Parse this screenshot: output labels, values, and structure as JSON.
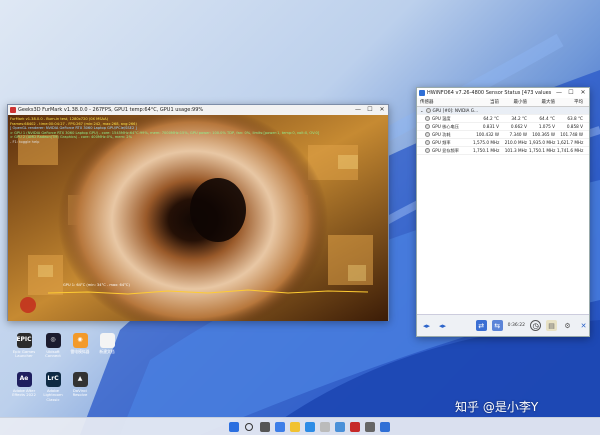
{
  "furmark": {
    "title": "Geeks3D FurMark v1.38.0.0 - 267FPS, GPU1 temp:64°C, GPU1 usage:99%",
    "osd": [
      {
        "text": "FurMark v1.38.0.0 - Burn-in test, 1280x720 (0X MSAA)",
        "color": "#ffe34a"
      },
      {
        "text": "Frames:68402 - time:00:04:27 - FPS:267 (min:242, max:268, avg:266)",
        "color": "#ffe34a"
      },
      {
        "text": "[ OpenGL renderer: NVIDIA GeForce RTX 3060 Laptop GPU/PCIe/SSE2 ]",
        "color": "#9fd9ff"
      },
      {
        "text": "> GPU 1 (NVIDIA GeForce RTX 3060 Laptop GPU) - core: 1545MHz:64°C:99%, mem: 7000MHz:15%, GPU power: 100.0% TDP, fan: 0%, limits:[power:1, temp:0, volt:0, OV:0]",
        "color": "#8ff08f"
      },
      {
        "text": "> GPU 2 (AMD Radeon(TM) Graphics) - core: 400MHz:0%, mem: 2%",
        "color": "#8ff08f"
      },
      {
        "text": "- F1: toggle help",
        "color": "#dddddd"
      }
    ],
    "graph_label": "GPU 1: 64°C (min: 34°C - max: 64°C)"
  },
  "hwinfo": {
    "title": "HWiNFO64 v7.26-4800 Sensor Status [473 values hidden]",
    "menu": [
      "传感器"
    ],
    "columns": [
      "传感器",
      "当前",
      "最小值",
      "最大值",
      "平均"
    ],
    "group": "GPU [#0]: NVIDIA G...",
    "rows": [
      {
        "name": "GPU 温度",
        "cur": "64.2 °C",
        "min": "34.2 °C",
        "max": "64.4 °C",
        "avg": "63.8 °C"
      },
      {
        "name": "GPU 核心电压",
        "cur": "0.831 V",
        "min": "0.662 V",
        "max": "1.075 V",
        "avg": "0.858 V"
      },
      {
        "name": "GPU 功耗",
        "cur": "100.432 W",
        "min": "7.340 W",
        "max": "100.365 W",
        "avg": "101.748 W"
      },
      {
        "name": "GPU 频率",
        "cur": "1,575.0 MHz",
        "min": "210.0 MHz",
        "max": "1,935.0 MHz",
        "avg": "1,621.7 MHz"
      },
      {
        "name": "GPU 显存频率",
        "cur": "1,750.1 MHz",
        "min": "101.3 MHz",
        "max": "1,750.1 MHz",
        "avg": "1,741.6 MHz"
      }
    ],
    "timer": "0:36:22"
  },
  "desktop_icons": [
    {
      "label": "Epic Games Launcher",
      "badge": "EPIC",
      "color": "#2b2b2b"
    },
    {
      "label": "Ubisoft Connect",
      "badge": "◎",
      "color": "#1b1b2e"
    },
    {
      "label": "雷电模拟器",
      "badge": "◉",
      "color": "#f39a2a"
    },
    {
      "label": "新建文档",
      "badge": "",
      "color": "#f4f4f4"
    },
    {
      "label": "Adobe After Effects 2022",
      "badge": "Ae",
      "color": "#1f1f5f"
    },
    {
      "label": "Adobe Lightroom Classic",
      "badge": "LrC",
      "color": "#0e2a44"
    },
    {
      "label": "DaVinci Resolve",
      "badge": "▲",
      "color": "#333"
    }
  ],
  "watermark": "知乎 @是小李Y"
}
